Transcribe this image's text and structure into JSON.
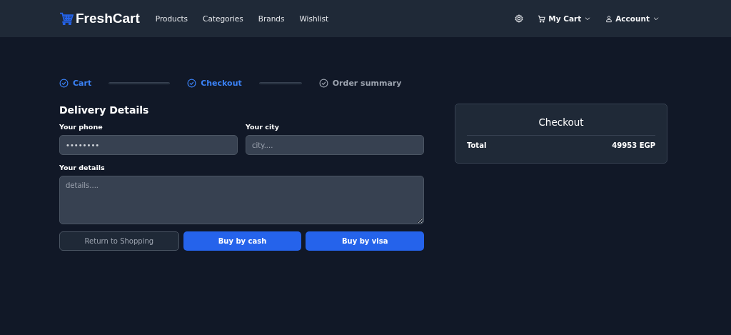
{
  "navbar": {
    "brand": "FreshCart",
    "links": [
      "Products",
      "Categories",
      "Brands",
      "Wishlist"
    ],
    "cart": "My Cart",
    "account": "Account"
  },
  "steps": [
    {
      "label": "Cart",
      "completed": true
    },
    {
      "label": "Checkout",
      "completed": true
    },
    {
      "label": "Order summary",
      "completed": false
    }
  ],
  "form": {
    "title": "Delivery Details",
    "phone": {
      "label": "Your phone",
      "value": "••••••••"
    },
    "city": {
      "label": "Your city",
      "placeholder": "city...."
    },
    "details": {
      "label": "Your details",
      "placeholder": "details...."
    },
    "buttons": [
      {
        "label": "Return to Shopping",
        "kind": "outline"
      },
      {
        "label": "Buy by cash",
        "kind": "primary"
      },
      {
        "label": "Buy by visa",
        "kind": "primary"
      }
    ]
  },
  "summary": {
    "title": "Checkout",
    "total_label": "Total",
    "total_value": "49953 EGP"
  }
}
